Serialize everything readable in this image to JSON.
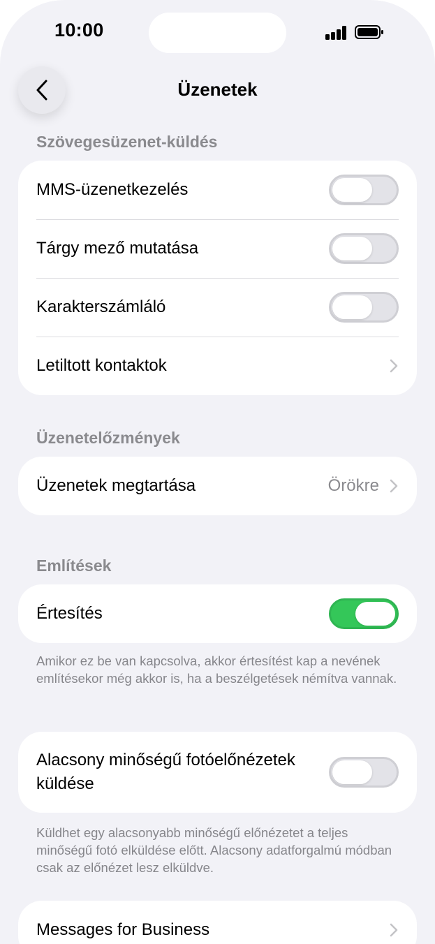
{
  "status_bar": {
    "time": "10:00"
  },
  "nav": {
    "title": "Üzenetek",
    "back_icon": "chevron-left-icon"
  },
  "sections": {
    "texting": {
      "header": "Szövegesüzenet-küldés",
      "rows": [
        {
          "label": "MMS-üzenetkezelés",
          "toggle_on": false
        },
        {
          "label": "Tárgy mező mutatása",
          "toggle_on": false
        },
        {
          "label": "Karakterszámláló",
          "toggle_on": false
        },
        {
          "label": "Letiltott kontaktok",
          "accessory": "chevron-right-icon"
        }
      ]
    },
    "history": {
      "header": "Üzenetelőzmények",
      "rows": [
        {
          "label": "Üzenetek megtartása",
          "value": "Örökre",
          "accessory": "chevron-right-icon"
        }
      ]
    },
    "mentions": {
      "header": "Említések",
      "rows": [
        {
          "label": "Értesítés",
          "toggle_on": true
        }
      ],
      "footnote": "Amikor ez be van kapcsolva, akkor értesítést kap a nevének említésekor még akkor is, ha a beszélgetések némítva vannak."
    },
    "low_quality": {
      "rows": [
        {
          "label": "Alacsony minőségű fotóelőnézetek küldése",
          "toggle_on": false
        }
      ],
      "footnote": "Küldhet egy alacsonyabb minőségű előnézetet a teljes minőségű fotó elküldése előtt. Alacsony adatforgalmú módban csak az előnézet lesz elküldve."
    },
    "business": {
      "rows": [
        {
          "label": "Messages for Business",
          "accessory": "chevron-right-icon"
        }
      ]
    }
  },
  "colors": {
    "background": "#f2f2f7",
    "toggle_on": "#34c759",
    "secondary_text": "#8a8a8e"
  }
}
